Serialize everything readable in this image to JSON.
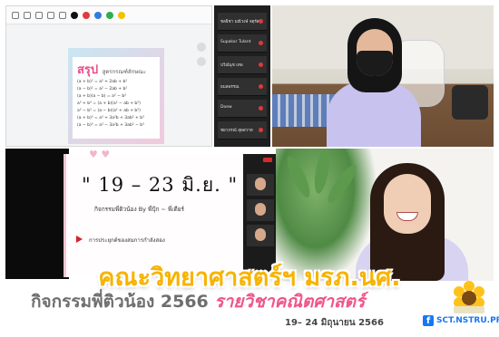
{
  "slide_notes": {
    "title": "สรุป",
    "title_rest": "สูตรกรณฑ์ลักษณะ",
    "formulas": [
      "(a + b)² = a² + 2ab + b²",
      "(a − b)² = a² − 2ab + b²",
      "(a + b)(a − b) = a² − b²",
      "a³ + b³ = (a + b)(a² − ab + b²)",
      "a³ − b³ = (a − b)(a² + ab + b²)",
      "(a + b)³ = a³ + 3a²b + 3ab² + b³",
      "(a − b)³ = a³ − 3a²b + 3ab² − b³"
    ]
  },
  "zoom_list": {
    "names": [
      "ชลธิชา มณีวงษ์ จตุรัส",
      "Supakar Tulant",
      "ปวีณ์นุช เทพ",
      "ธมลพรรณ",
      "Doew",
      "ชยาภรณ์ สุดสวาท"
    ]
  },
  "slide_date": {
    "date": "\" 19 – 23 มิ.ย. \"",
    "byline": "กิจกรรมพี่ติวน้อง  By  พี่ปุ้ก ~ พี่เดียร์",
    "bullet_text": "การประยุกต์ของสมการกำลังสอง"
  },
  "banner": {
    "title": "คณะวิทยาศาสตร์ฯ มรภ.นศ.",
    "subtitle_dark": "กิจกรรมพี่ติวน้อง 2566",
    "subtitle_pink": "รายวิชาคณิตศาสตร์",
    "date_line": "19– 24 มิถุนายน 2566",
    "page_name": "SCT.NSTRU.PR"
  },
  "colors": {
    "title_yellow": "#f7b300",
    "subtitle_pink": "#f0548a",
    "facebook_blue": "#1877f2"
  }
}
